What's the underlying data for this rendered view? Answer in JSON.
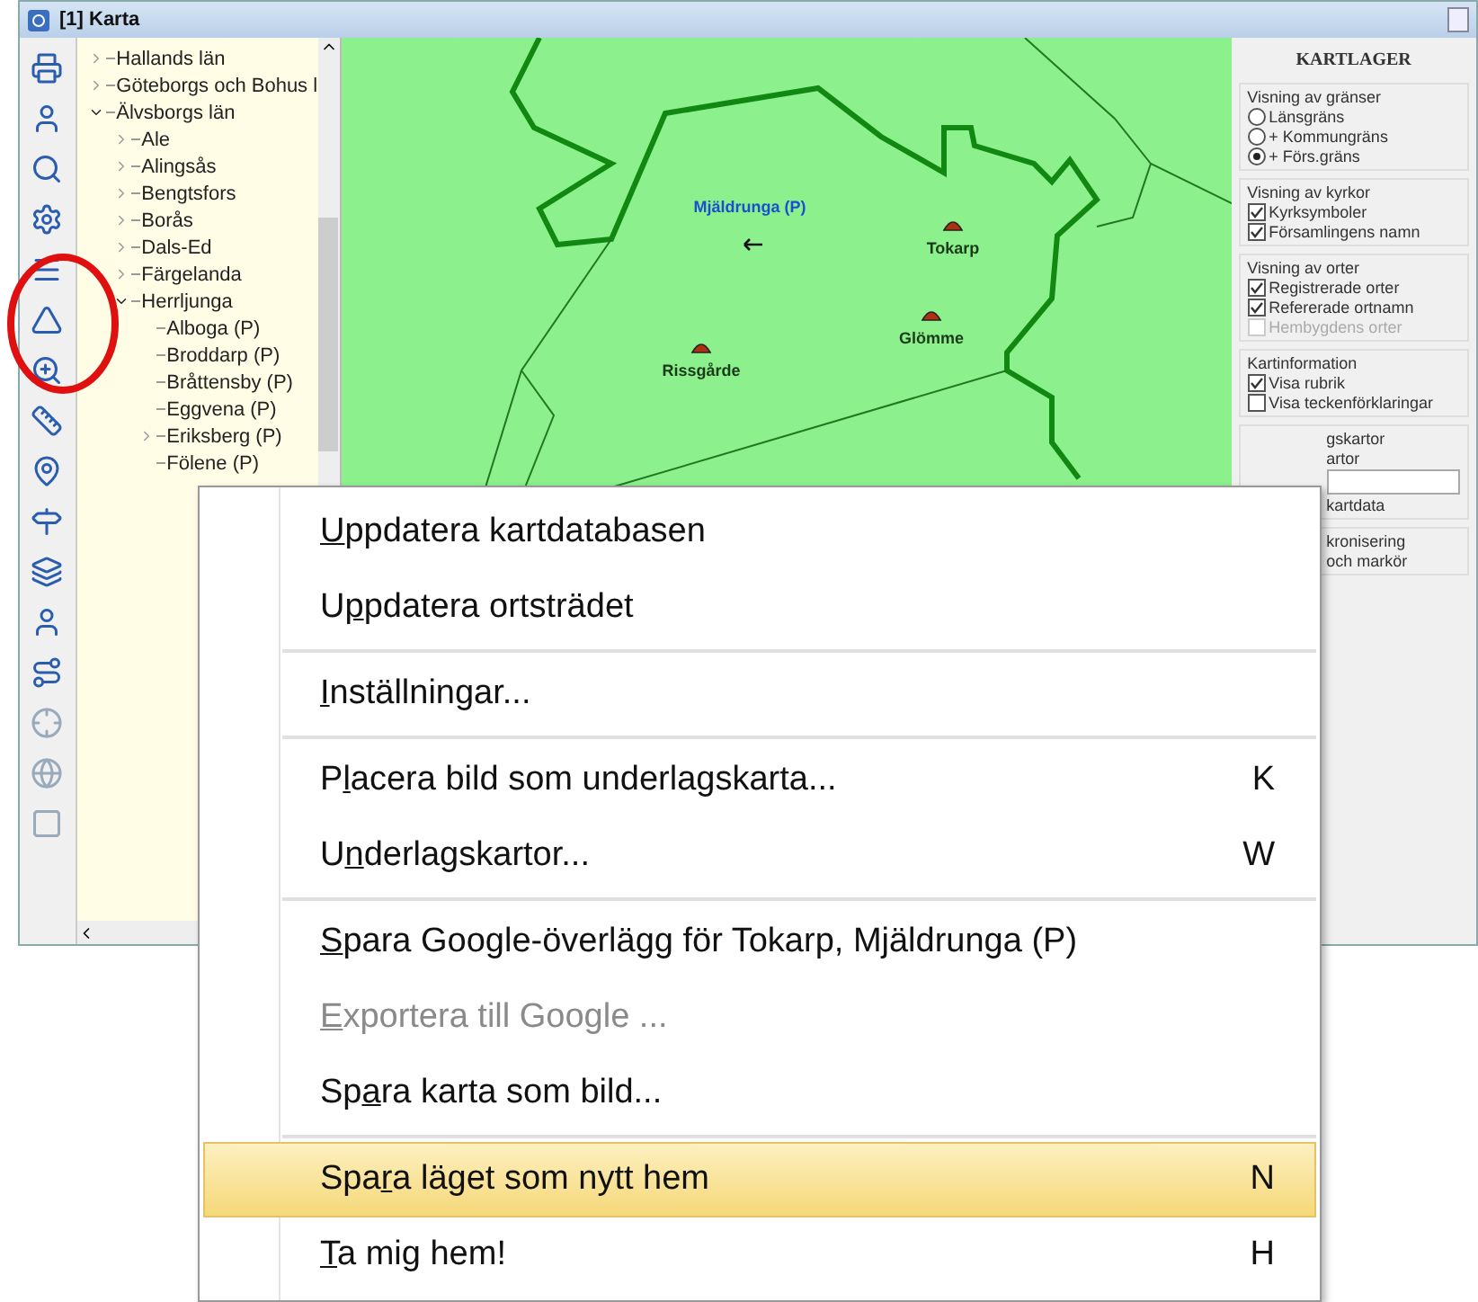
{
  "window": {
    "title": "[1] Karta"
  },
  "tree": [
    {
      "label": "Hallands län",
      "kind": "branch",
      "expanded": false
    },
    {
      "label": "Göteborgs och Bohus l",
      "kind": "branch",
      "expanded": false
    },
    {
      "label": "Älvsborgs län",
      "kind": "branch",
      "expanded": true,
      "children": [
        {
          "label": "Ale",
          "kind": "branch",
          "expanded": false
        },
        {
          "label": "Alingsås",
          "kind": "branch",
          "expanded": false
        },
        {
          "label": "Bengtsfors",
          "kind": "branch",
          "expanded": false
        },
        {
          "label": "Borås",
          "kind": "branch",
          "expanded": false
        },
        {
          "label": "Dals-Ed",
          "kind": "branch",
          "expanded": false
        },
        {
          "label": "Färgelanda",
          "kind": "branch",
          "expanded": false
        },
        {
          "label": "Herrljunga",
          "kind": "branch",
          "expanded": true,
          "children": [
            {
              "label": "Alboga (P)",
              "kind": "leaf"
            },
            {
              "label": "Broddarp (P)",
              "kind": "leaf"
            },
            {
              "label": "Bråttensby (P)",
              "kind": "leaf"
            },
            {
              "label": "Eggvena (P)",
              "kind": "leaf"
            },
            {
              "label": "Eriksberg (P)",
              "kind": "branch",
              "expanded": false
            },
            {
              "label": "Fölene (P)",
              "kind": "leaf"
            }
          ]
        }
      ]
    }
  ],
  "map": {
    "labels": [
      {
        "text": "Mjäldrunga (P)",
        "kind": "parish"
      },
      {
        "text": "Tokarp",
        "kind": "church"
      },
      {
        "text": "Glömme",
        "kind": "church"
      },
      {
        "text": "Rissgårde",
        "kind": "church"
      }
    ]
  },
  "layers": {
    "title": "KARTLAGER",
    "groups": [
      {
        "legend": "Visning av gränser",
        "items": [
          {
            "kind": "radio",
            "label": "Länsgräns",
            "selected": false,
            "disabled": false
          },
          {
            "kind": "radio",
            "label": "+ Kommungräns",
            "selected": false,
            "disabled": false
          },
          {
            "kind": "radio",
            "label": "+ Förs.gräns",
            "selected": true,
            "disabled": false
          }
        ]
      },
      {
        "legend": "Visning av kyrkor",
        "items": [
          {
            "kind": "checkbox",
            "label": "Kyrksymboler",
            "checked": true,
            "disabled": false
          },
          {
            "kind": "checkbox",
            "label": "Församlingens namn",
            "checked": true,
            "disabled": false
          }
        ]
      },
      {
        "legend": "Visning av orter",
        "items": [
          {
            "kind": "checkbox",
            "label": "Registrerade orter",
            "checked": true,
            "disabled": false
          },
          {
            "kind": "checkbox",
            "label": "Refererade ortnamn",
            "checked": true,
            "disabled": false
          },
          {
            "kind": "checkbox",
            "label": "Hembygdens orter",
            "checked": false,
            "disabled": true
          }
        ]
      },
      {
        "legend": "Kartinformation",
        "items": [
          {
            "kind": "checkbox",
            "label": "Visa rubrik",
            "checked": true,
            "disabled": false
          },
          {
            "kind": "checkbox",
            "label": "Visa teckenförklaringar",
            "checked": false,
            "disabled": false
          }
        ]
      }
    ],
    "partial_groups": [
      {
        "legend": "gskartor",
        "lines": [
          {
            "kind": "text",
            "text": "artor"
          },
          {
            "kind": "field"
          },
          {
            "kind": "text",
            "text": "kartdata"
          }
        ]
      },
      {
        "legend": "kronisering",
        "lines": [
          {
            "kind": "text",
            "text": "och markör"
          }
        ]
      }
    ]
  },
  "context_menu": [
    {
      "kind": "item",
      "key": "U",
      "post": "ppdatera kartdatabasen",
      "disabled": false,
      "selected": false
    },
    {
      "kind": "item",
      "pre": "U",
      "key": "p",
      "post": "pdatera ortsträdet",
      "disabled": false,
      "selected": false
    },
    {
      "kind": "separator"
    },
    {
      "kind": "item",
      "key": "I",
      "post": "nställningar...",
      "disabled": false,
      "selected": false
    },
    {
      "kind": "separator"
    },
    {
      "kind": "item",
      "pre": "P",
      "key": "l",
      "post": "acera bild som underlagskarta...",
      "shortcut": "K",
      "disabled": false,
      "selected": false
    },
    {
      "kind": "item",
      "pre": "U",
      "key": "n",
      "post": "derlagskartor...",
      "shortcut": "W",
      "disabled": false,
      "selected": false
    },
    {
      "kind": "separator"
    },
    {
      "kind": "item",
      "key": "S",
      "post": "para Google-överlägg för Tokarp, Mjäldrunga (P)",
      "disabled": false,
      "selected": false
    },
    {
      "kind": "item",
      "key": "E",
      "post": "xportera till Google ...",
      "disabled": true,
      "selected": false
    },
    {
      "kind": "item",
      "pre": "Sp",
      "key": "a",
      "post": "ra karta som bild...",
      "disabled": false,
      "selected": false
    },
    {
      "kind": "separator"
    },
    {
      "kind": "item",
      "pre": "Spa",
      "key": "r",
      "post": "a läget som nytt hem",
      "shortcut": "N",
      "disabled": false,
      "selected": true
    },
    {
      "kind": "item",
      "key": "T",
      "post": "a mig hem!",
      "shortcut": "H",
      "disabled": false,
      "selected": false
    }
  ]
}
